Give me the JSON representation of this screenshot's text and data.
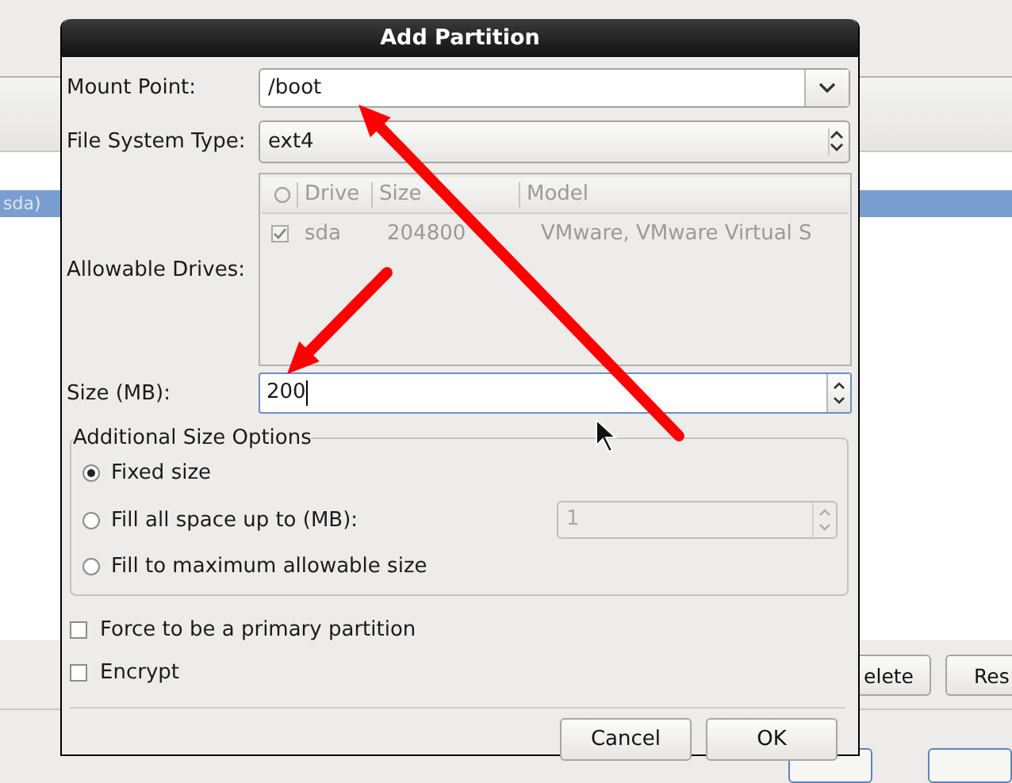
{
  "background": {
    "partition_row": "sda)",
    "buttons": [
      "elete",
      "Res"
    ]
  },
  "dialog": {
    "title": "Add Partition",
    "mount_point": {
      "label": "Mount Point:",
      "value": "/boot"
    },
    "file_system_type": {
      "label": "File System Type:",
      "value": "ext4"
    },
    "allowable_drives": {
      "label": "Allowable Drives:",
      "disabled": true,
      "columns": [
        "Drive",
        "Size",
        "Model"
      ],
      "rows": [
        {
          "checked": true,
          "drive": "sda",
          "size": "204800",
          "model": "VMware, VMware Virtual S"
        }
      ]
    },
    "size": {
      "label": "Size (MB):",
      "value": "200"
    },
    "size_options": {
      "title": "Additional Size Options",
      "options": [
        {
          "label": "Fixed size",
          "selected": true
        },
        {
          "label": "Fill all space up to (MB):",
          "selected": false,
          "field_value": "1",
          "field_disabled": true
        },
        {
          "label": "Fill to maximum allowable size",
          "selected": false
        }
      ]
    },
    "checkboxes": [
      {
        "label": "Force to be a primary partition",
        "checked": false
      },
      {
        "label": "Encrypt",
        "checked": false
      }
    ],
    "buttons": [
      "Cancel",
      "OK"
    ]
  },
  "annotations": [
    {
      "kind": "arrow"
    },
    {
      "kind": "arrow"
    }
  ]
}
